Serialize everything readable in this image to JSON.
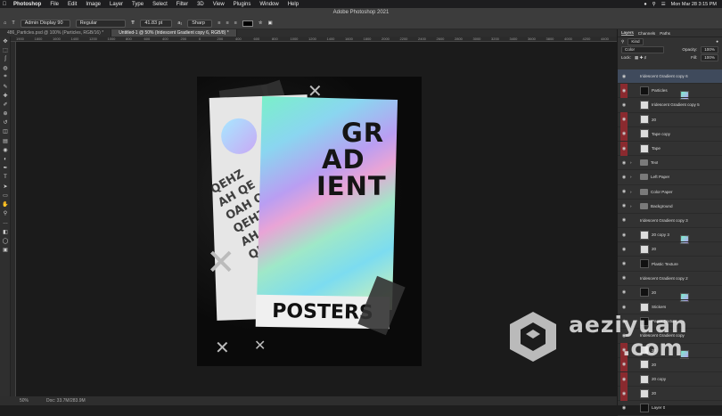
{
  "menubar": {
    "app": "Photoshop",
    "items": [
      "File",
      "Edit",
      "Image",
      "Layer",
      "Type",
      "Select",
      "Filter",
      "3D",
      "View",
      "Plugins",
      "Window",
      "Help"
    ],
    "clock": "Mon Mar 28  3:15 PM"
  },
  "window_title": "Adobe Photoshop 2021",
  "options": {
    "font_family": "Admin Display 90",
    "font_style": "Regular",
    "font_size": "41.83 pt",
    "antialias": "Sharp",
    "text_color": "#000000"
  },
  "tabs": [
    {
      "label": "486_Particles.psd @ 100% (Particles, RGB/16) *",
      "active": false
    },
    {
      "label": "Untitled-1 @ 50% (Iridescent Gradient copy 6, RGB/8) *",
      "active": true
    }
  ],
  "ruler_ticks": [
    "1900",
    "1800",
    "1600",
    "1400",
    "1200",
    "1000",
    "800",
    "600",
    "400",
    "200",
    "0",
    "200",
    "400",
    "600",
    "800",
    "1000",
    "1200",
    "1400",
    "1600",
    "1800",
    "2000",
    "2200",
    "2400",
    "2600",
    "2800",
    "3000",
    "3200",
    "3400",
    "3600",
    "3800",
    "4000",
    "4200",
    "4400"
  ],
  "toolbar_icons": [
    "move-icon",
    "marquee-icon",
    "lasso-icon",
    "quick-select-icon",
    "crop-icon",
    "eyedropper-icon",
    "healing-icon",
    "brush-icon",
    "stamp-icon",
    "history-brush-icon",
    "eraser-icon",
    "gradient-icon",
    "blur-icon",
    "dodge-icon",
    "pen-icon",
    "type-icon",
    "path-select-icon",
    "rectangle-icon",
    "hand-icon",
    "zoom-icon",
    "more-icon",
    "colors-icon",
    "quickmask-icon",
    "screenmode-icon"
  ],
  "artwork": {
    "heading_lines": [
      "GR",
      "AD",
      "IENT"
    ],
    "pattern_text": [
      "QEHZ",
      "AH QE",
      "OAH QE",
      "QEHZI",
      "AH QEH",
      "QEHZ"
    ],
    "posters": "POSTERS"
  },
  "status": {
    "zoom": "50%",
    "doc": "Doc: 33.7M/283.9M"
  },
  "panel": {
    "tabs": [
      {
        "label": "Layers",
        "on": true
      },
      {
        "label": "Channels",
        "on": false
      },
      {
        "label": "Paths",
        "on": false
      }
    ],
    "kind": "Kind",
    "blend_mode": "Color",
    "opacity_label": "Opacity:",
    "opacity": "100%",
    "lock_label": "Lock:",
    "fill_label": "Fill:",
    "fill": "100%"
  },
  "layers": [
    {
      "name": "Iridescent Gradient copy 6",
      "thumb": "holo",
      "red": false,
      "sel": true
    },
    {
      "name": "Particles",
      "thumb": "dark",
      "red": true
    },
    {
      "name": "Iridescent Gradient copy 5",
      "thumb": "light",
      "red": false
    },
    {
      "name": "20",
      "thumb": "light",
      "red": true
    },
    {
      "name": "Tape copy",
      "thumb": "light",
      "red": true
    },
    {
      "name": "Tape",
      "thumb": "light",
      "red": true
    },
    {
      "name": "Text",
      "thumb": "folder",
      "red": false
    },
    {
      "name": "Left Paper",
      "thumb": "folder",
      "red": false
    },
    {
      "name": "Color Paper",
      "thumb": "folder",
      "red": false
    },
    {
      "name": "Background",
      "thumb": "folder",
      "red": false
    },
    {
      "name": "Iridescent Gradient copy 3",
      "thumb": "holo",
      "red": false
    },
    {
      "name": "20 copy 3",
      "thumb": "light",
      "red": false
    },
    {
      "name": "20",
      "thumb": "light",
      "red": false
    },
    {
      "name": "Plastic Texture",
      "thumb": "dark",
      "red": false
    },
    {
      "name": "Iridescent Gradient copy 2",
      "thumb": "holo",
      "red": false
    },
    {
      "name": "20",
      "thumb": "dark",
      "red": false
    },
    {
      "name": "Stickers",
      "thumb": "light",
      "red": false
    },
    {
      "name": "Paper Texture",
      "thumb": "dark",
      "red": false
    },
    {
      "name": "Iridescent Gradient copy",
      "thumb": "holo",
      "red": false
    },
    {
      "name": "20",
      "thumb": "light",
      "red": true
    },
    {
      "name": "20",
      "thumb": "light",
      "red": true
    },
    {
      "name": "20 copy",
      "thumb": "light",
      "red": true
    },
    {
      "name": "20",
      "thumb": "light",
      "red": true
    },
    {
      "name": "Layer 0",
      "thumb": "dark",
      "red": false
    }
  ],
  "watermark": {
    "line1": "aeziyuan",
    "line2": ".com"
  }
}
